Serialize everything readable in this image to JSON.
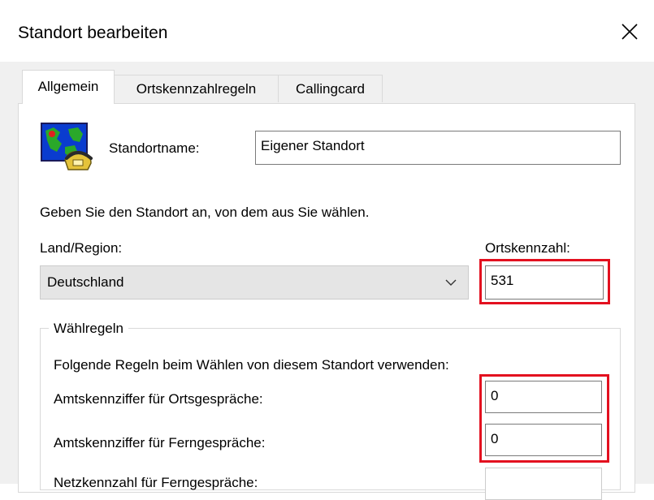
{
  "window": {
    "title": "Standort bearbeiten"
  },
  "tabs": [
    {
      "label": "Allgemein",
      "active": true
    },
    {
      "label": "Ortskennzahlregeln",
      "active": false
    },
    {
      "label": "Callingcard",
      "active": false
    }
  ],
  "general": {
    "location_name_label": "Standortname:",
    "location_name_value": "Eigener Standort",
    "instruction": "Geben Sie den Standort an, von dem aus Sie wählen.",
    "country_label": "Land/Region:",
    "country_value": "Deutschland",
    "area_code_label": "Ortskennzahl:",
    "area_code_value": "531"
  },
  "dialing_rules": {
    "group_title": "Wählregeln",
    "instruction": "Folgende Regeln beim Wählen von diesem Standort verwenden:",
    "local_access_label": "Amtskennziffer für Ortsgespräche:",
    "local_access_value": "0",
    "long_distance_access_label": "Amtskennziffer für Ferngespräche:",
    "long_distance_access_value": "0",
    "carrier_code_label": "Netzkennzahl für Ferngespräche:",
    "carrier_code_value": ""
  },
  "icons": {
    "close": "close-icon",
    "location": "map-phone-icon",
    "dropdown": "chevron-down-icon"
  },
  "colors": {
    "highlight": "#e3101f",
    "dialog_bg": "#f0f0f0",
    "combo_bg": "#e5e5e5"
  }
}
